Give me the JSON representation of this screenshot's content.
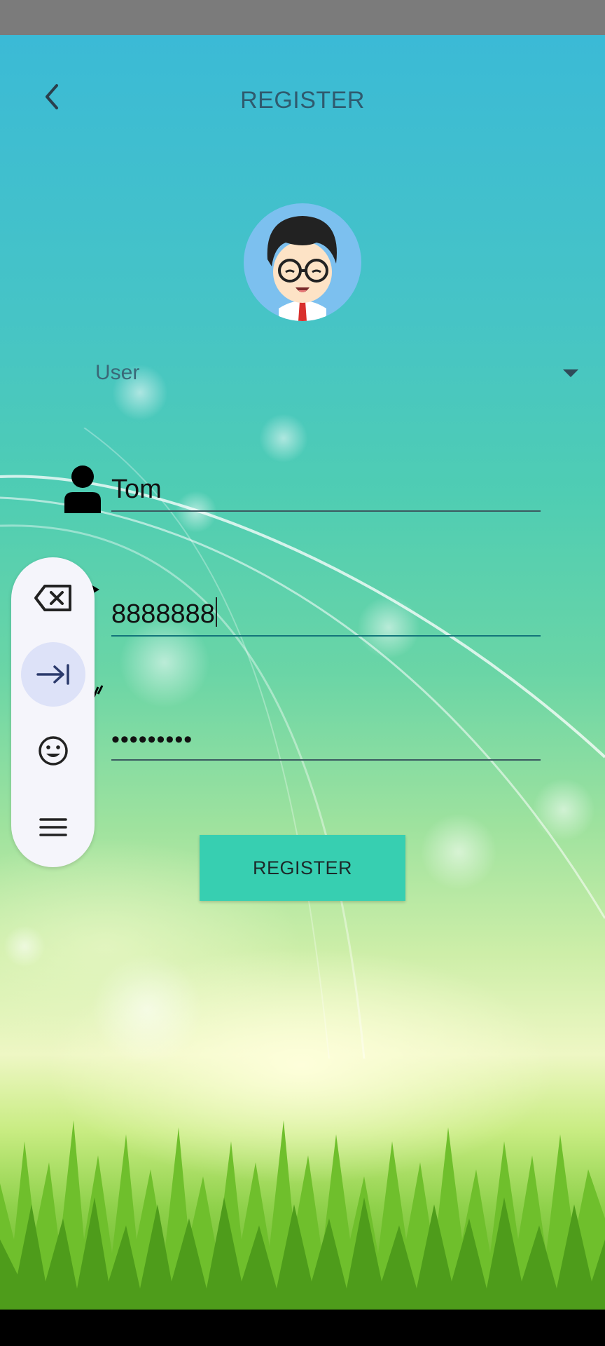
{
  "header": {
    "title": "REGISTER"
  },
  "role_select": {
    "value": "User"
  },
  "form": {
    "username_value": "Tom",
    "phone_value": "8888888",
    "password_masked": "•••••••••"
  },
  "actions": {
    "register_label": "REGISTER"
  },
  "keyboard_toolbar": {
    "items": [
      "backspace-icon",
      "tab-icon",
      "emoji-icon",
      "menu-icon"
    ],
    "selected": "tab-icon"
  },
  "colors": {
    "button": "#37cfb1",
    "title": "#2f5a6e",
    "toolbar_bg": "#f5f5fb",
    "toolbar_selected": "#dde2f8"
  }
}
